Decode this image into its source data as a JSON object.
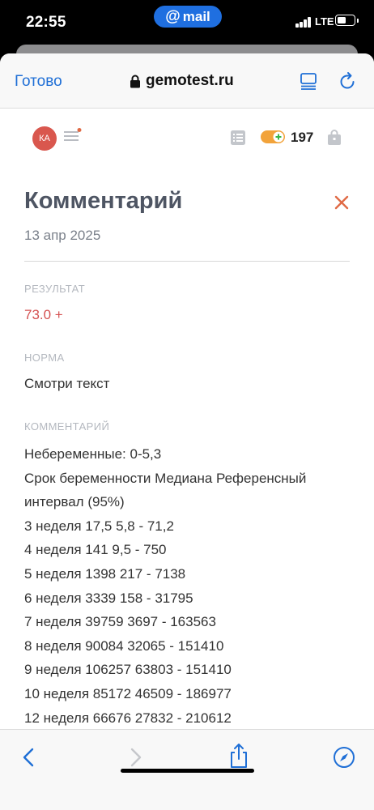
{
  "status": {
    "time": "22:55",
    "pill_label": "mail",
    "network": "LTE"
  },
  "browser": {
    "done_label": "Готово",
    "domain": "gemotest.ru"
  },
  "header": {
    "avatar_initials": "КА",
    "bonus_count": "197"
  },
  "page": {
    "title": "Комментарий",
    "date": "13 апр 2025",
    "result_label": "РЕЗУЛЬТАТ",
    "result_value": "73.0 +",
    "norm_label": "НОРМА",
    "norm_value": "Смотри текст",
    "comment_label": "КОММЕНТАРИЙ",
    "comment_lines": [
      "Небеременные: 0-5,3",
      "Срок беременности Медиана Референсный интервал (95%)",
      "3 неделя 17,5 5,8 - 71,2",
      "4 неделя 141 9,5 - 750",
      "5 неделя 1398 217 - 7138",
      "6 неделя 3339 158 - 31795",
      "7 неделя 39759 3697 - 163563",
      "8 неделя 90084 32065 - 151410",
      "9 неделя 106257 63803 - 151410",
      "10 неделя 85172 46509 - 186977",
      "12 неделя 66676 27832 - 210612"
    ]
  },
  "colors": {
    "accent_blue": "#1f6fd6",
    "avatar_red": "#d9574e",
    "result_red": "#d45050",
    "close_orange": "#e06a45",
    "bonus_orange": "#f2a33a"
  }
}
